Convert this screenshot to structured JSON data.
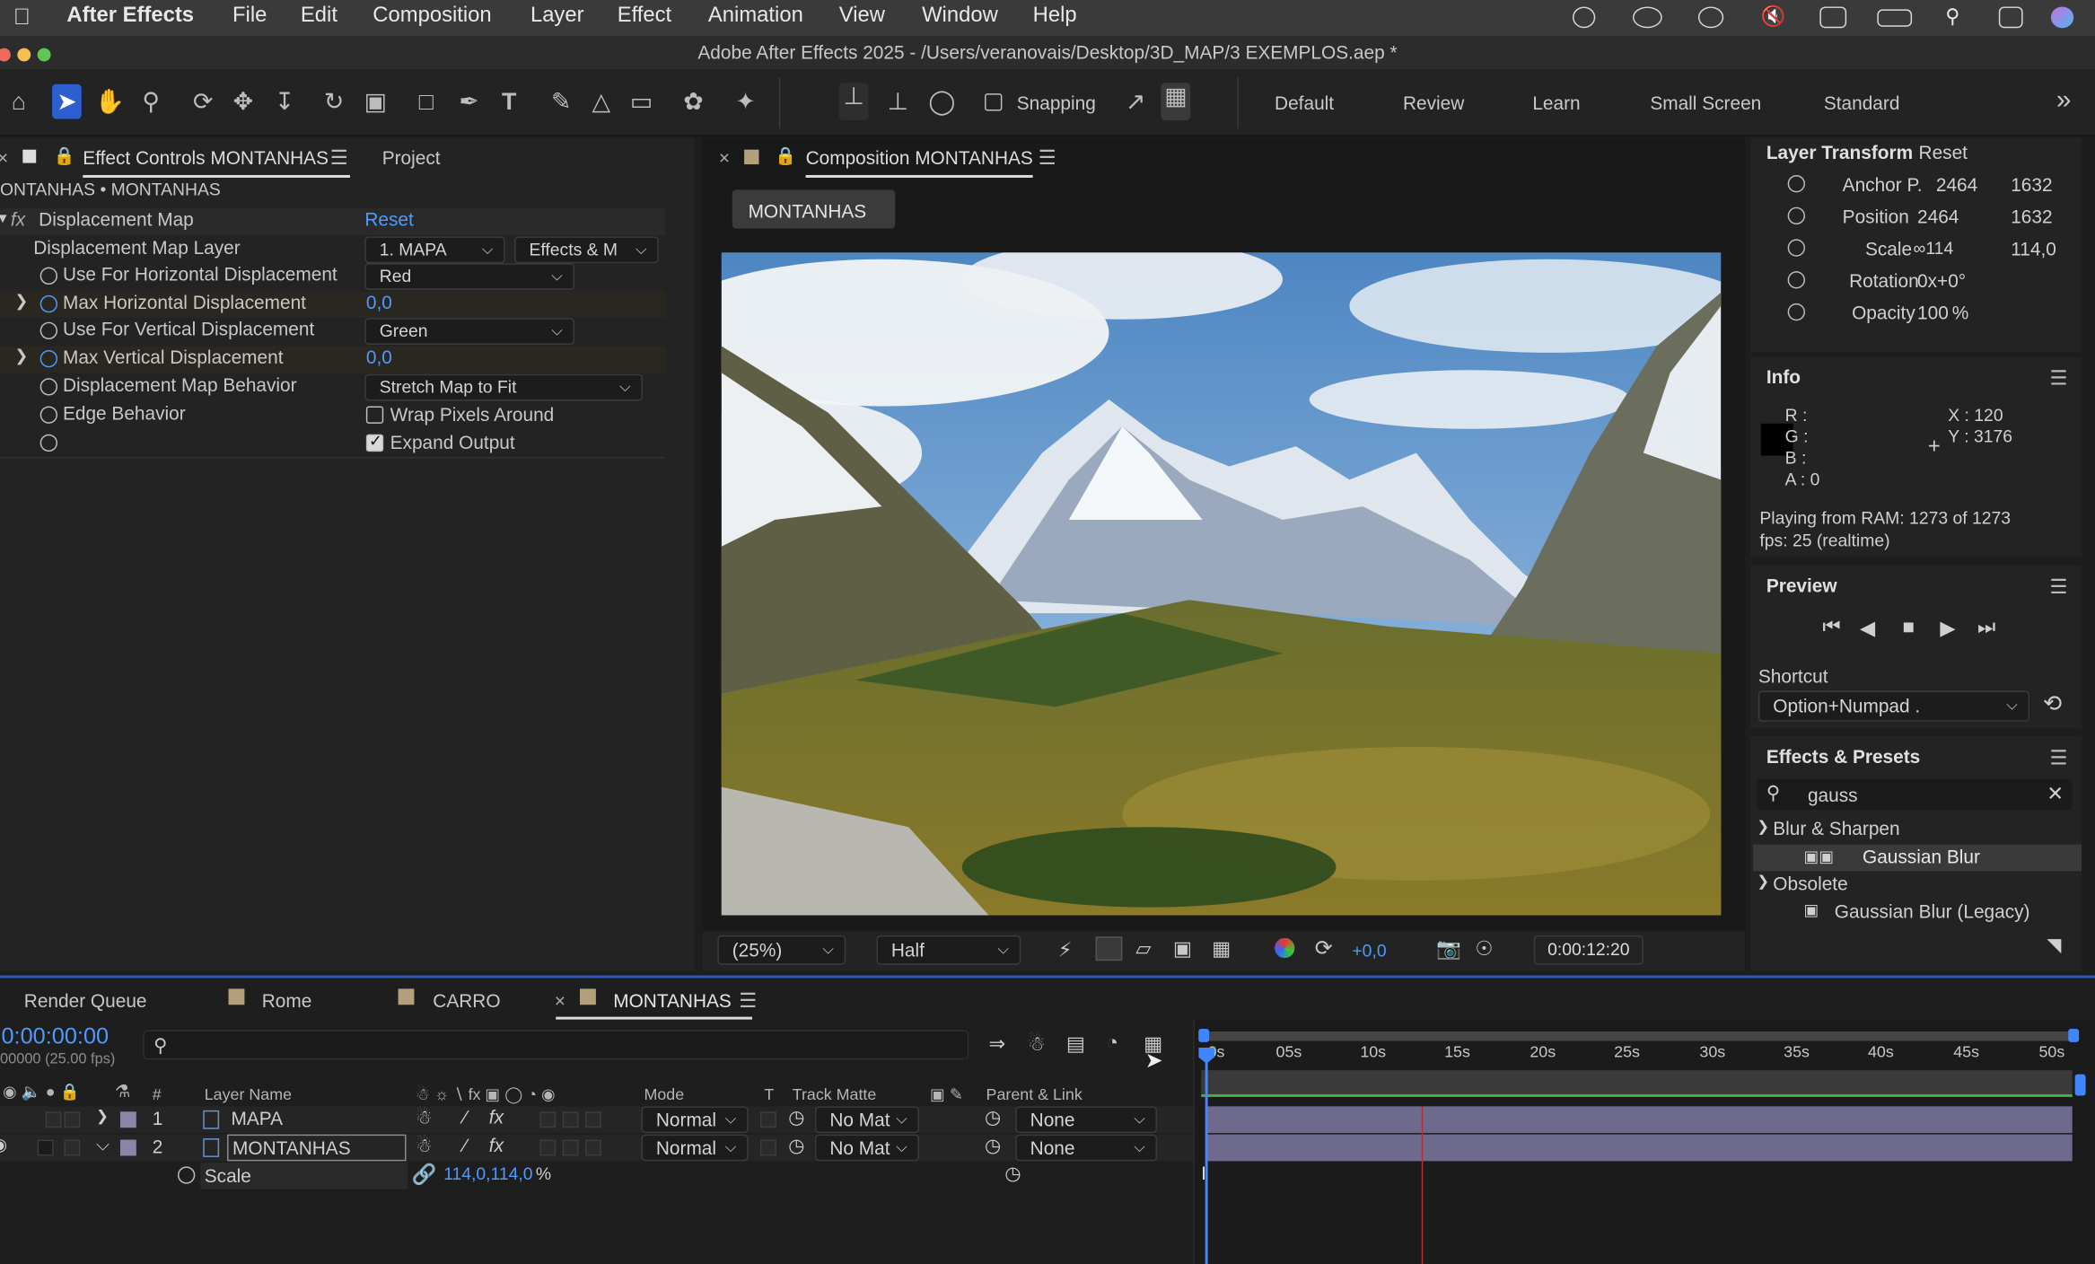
{
  "menubar": {
    "app_name": "After Effects",
    "items": [
      "File",
      "Edit",
      "Composition",
      "Layer",
      "Effect",
      "Animation",
      "View",
      "Window",
      "Help"
    ]
  },
  "window_title": "Adobe After Effects 2025 - /Users/veranovais/Desktop/3D_MAP/3 EXEMPLOS.aep *",
  "toolbar": {
    "snapping_label": "Snapping",
    "workspaces": [
      "Default",
      "Review",
      "Learn",
      "Small Screen",
      "Standard"
    ],
    "more_glyph": "»"
  },
  "effect_controls": {
    "tab_label": "Effect Controls MONTANHAS",
    "project_tab": "Project",
    "breadcrumb": "ONTANHAS • MONTANHAS",
    "effect_name": "Displacement Map",
    "reset_label": "Reset",
    "fx_glyph": "fx",
    "props": [
      {
        "label": "Displacement Map Layer",
        "value": "1. MAPA",
        "value2": "Effects & M"
      },
      {
        "label": "Use For Horizontal Displacement",
        "value": "Red"
      },
      {
        "label": "Max Horizontal Displacement",
        "value": "0,0"
      },
      {
        "label": "Use For Vertical Displacement",
        "value": "Green"
      },
      {
        "label": "Max Vertical Displacement",
        "value": "0,0"
      },
      {
        "label": "Displacement Map Behavior",
        "value": "Stretch Map to Fit"
      },
      {
        "label": "Edge Behavior",
        "value": "Wrap Pixels Around"
      },
      {
        "label": "",
        "value": "Expand Output"
      }
    ]
  },
  "composition": {
    "tab_label": "Composition MONTANHAS",
    "comp_button": "MONTANHAS",
    "zoom": "(25%)",
    "resolution": "Half",
    "exposure": "+0,0",
    "timecode": "0:00:12:20"
  },
  "layer_transform": {
    "title": "Layer Transform",
    "reset": "Reset",
    "rows": [
      {
        "label": "Anchor P.",
        "v1": "2464",
        "v2": "1632"
      },
      {
        "label": "Position",
        "v1": "2464",
        "v2": "1632"
      },
      {
        "label": "Scale",
        "v1": "∞114",
        "v2": "114,0"
      },
      {
        "label": "Rotation",
        "v1": "0x+0°",
        "v2": ""
      },
      {
        "label": "Opacity",
        "v1": "100",
        "v2": "%"
      }
    ]
  },
  "info": {
    "title": "Info",
    "r": "R :",
    "g": "G :",
    "b": "B :",
    "a": "A : 0",
    "x": "X : 120",
    "y": "Y : 3176",
    "line1": "Playing from RAM: 1273 of 1273",
    "line2": "fps: 25 (realtime)"
  },
  "preview": {
    "title": "Preview",
    "shortcut_label": "Shortcut",
    "shortcut_value": "Option+Numpad ."
  },
  "effects_presets": {
    "title": "Effects & Presets",
    "search_value": "gauss",
    "groups": [
      {
        "name": "Blur & Sharpen",
        "item": "Gaussian Blur"
      },
      {
        "name": "Obsolete",
        "item": "Gaussian Blur (Legacy)"
      }
    ]
  },
  "timeline": {
    "tabs": [
      "Render Queue",
      "Rome",
      "CARRO",
      "MONTANHAS"
    ],
    "timecode": "0:00:00:00",
    "timecode_sub": "00000 (25.00 fps)",
    "columns": {
      "num": "#",
      "layer_name": "Layer Name",
      "mode": "Mode",
      "t": "T",
      "track_matte": "Track Matte",
      "parent": "Parent & Link"
    },
    "ticks": [
      "0s",
      "05s",
      "10s",
      "15s",
      "20s",
      "25s",
      "30s",
      "35s",
      "40s",
      "45s",
      "50s"
    ],
    "layers": [
      {
        "num": "1",
        "name": "MAPA",
        "mode": "Normal",
        "matte": "No Mat",
        "parent": "None"
      },
      {
        "num": "2",
        "name": "MONTANHAS",
        "mode": "Normal",
        "matte": "No Mat",
        "parent": "None"
      }
    ],
    "scale_label": "Scale",
    "scale_value": "114,0,114,0",
    "scale_unit": "%"
  }
}
